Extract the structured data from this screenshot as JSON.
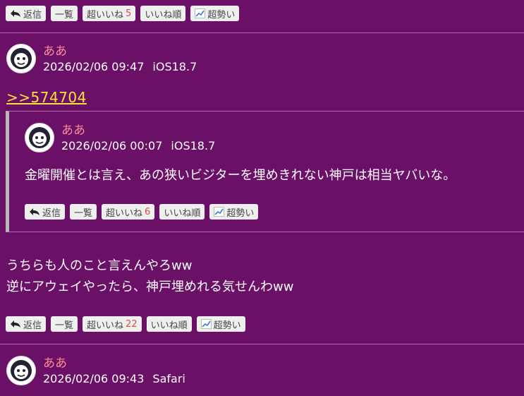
{
  "buttons": {
    "reply": "返信",
    "list": "一覧",
    "super_like": "超いいね",
    "like_order": "いいね順",
    "super_trend": "超勢い"
  },
  "post_top": {
    "super_like_count": "5"
  },
  "post1": {
    "name": "ああ",
    "date": "2026/02/06 09:47",
    "device": "iOS18.7",
    "anchor": ">>574704",
    "quote": {
      "name": "ああ",
      "date": "2026/02/06 00:07",
      "device": "iOS18.7",
      "text": "金曜開催とは言え、あの狭いビジターを埋めきれない神戸は相当ヤバいな。",
      "super_like_count": "6"
    },
    "text_line1": "うちらも人のこと言えんやろww",
    "text_line2": "逆にアウェイやったら、神戸埋めれる気せんわww",
    "super_like_count": "22"
  },
  "post2": {
    "name": "ああ",
    "date": "2026/02/06 09:43",
    "device": "Safari"
  },
  "colors": {
    "background": "#6b1067",
    "name": "#ff8a9a",
    "anchor": "#ffe33a",
    "count": "#e04a4a"
  }
}
